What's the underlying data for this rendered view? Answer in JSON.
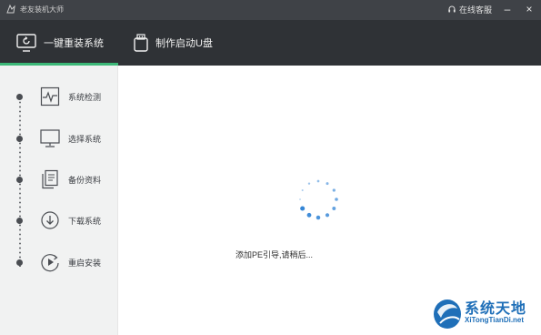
{
  "window": {
    "app_title": "老友装机大师",
    "support_label": "在线客服",
    "minimize_glyph": "–",
    "close_glyph": "×"
  },
  "tabs": [
    {
      "label": "一键重装系统",
      "icon": "monitor-refresh-icon",
      "active": true
    },
    {
      "label": "制作启动U盘",
      "icon": "usb-drive-icon",
      "active": false
    }
  ],
  "sidebar": {
    "steps": [
      {
        "label": "系统检测",
        "icon": "pulse-monitor-icon"
      },
      {
        "label": "选择系统",
        "icon": "desktop-icon"
      },
      {
        "label": "备份资料",
        "icon": "documents-icon"
      },
      {
        "label": "下载系统",
        "icon": "download-icon"
      },
      {
        "label": "重启安装",
        "icon": "restart-play-icon"
      }
    ]
  },
  "main": {
    "status_text": "添加PE引导,请稍后..."
  },
  "watermark": {
    "title": "系统天地",
    "url": "XiTongTianDi.net"
  },
  "colors": {
    "titlebar": "#3f4247",
    "tabbar": "#2f3236",
    "accent": "#3cb878",
    "spinner": "#2a7fd4",
    "watermark": "#1f6fb8"
  }
}
